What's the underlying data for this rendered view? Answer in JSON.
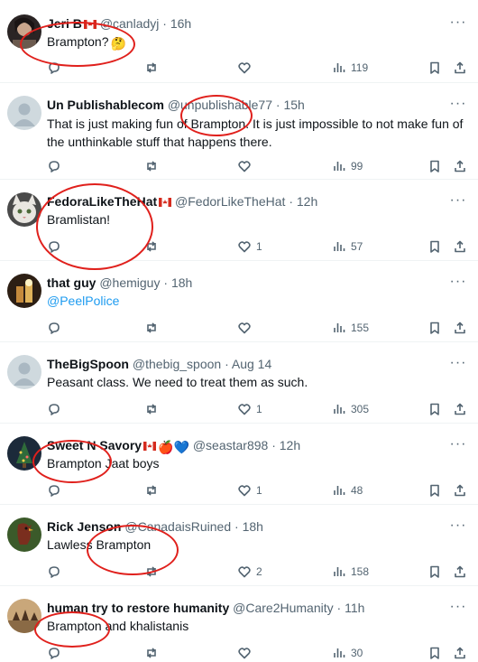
{
  "tweets": [
    {
      "name": "Jeri B",
      "flag": "ca",
      "handle": "@canladyj",
      "time": "16h",
      "text": "Brampton?",
      "text_emoji": "🤔",
      "replies": "",
      "retweets": "",
      "likes": "",
      "views": "119"
    },
    {
      "name": "Un Publishablecom",
      "handle": "@unpublishable77",
      "time": "15h",
      "text": "That is just making fun of Brampton.  It is just impossible to not make fun of the unthinkable stuff that happens there.",
      "replies": "",
      "retweets": "",
      "likes": "",
      "views": "99"
    },
    {
      "name": "FedoraLikeTheHat",
      "flag": "ca",
      "handle": "@FedorLikeTheHat",
      "time": "12h",
      "text": "Bramlistan!",
      "replies": "",
      "retweets": "",
      "likes": "1",
      "views": "57"
    },
    {
      "name": "that guy",
      "handle": "@hemiguy",
      "time": "18h",
      "text": "@PeelPolice",
      "replies": "",
      "retweets": "",
      "likes": "",
      "views": "155"
    },
    {
      "name": "TheBigSpoon",
      "handle": "@thebig_spoon",
      "time": "Aug 14",
      "text": "Peasant class. We need to treat them as such.",
      "replies": "",
      "retweets": "",
      "likes": "1",
      "views": "305"
    },
    {
      "name": "Sweet N Savory",
      "flag": "ca",
      "name_emojis": "🍎💙",
      "handle": "@seastar898",
      "time": "12h",
      "text": "Brampton  Jaat boys",
      "replies": "",
      "retweets": "",
      "likes": "1",
      "views": "48"
    },
    {
      "name": "Rick Jenson",
      "handle": "@CanadaisRuined",
      "time": "18h",
      "text": "Lawless Brampton",
      "replies": "",
      "retweets": "",
      "likes": "2",
      "views": "158"
    },
    {
      "name": "human try to restore humanity",
      "handle": "@Care2Humanity",
      "time": "11h",
      "text": "Brampton and khalistanis",
      "replies": "",
      "retweets": "",
      "likes": "",
      "views": "30"
    }
  ],
  "separator": "·",
  "more_glyph": "···",
  "highlight_color": "#e0201c",
  "icons": [
    "reply-icon",
    "retweet-icon",
    "like-icon",
    "views-icon",
    "bookmark-icon",
    "share-icon"
  ]
}
